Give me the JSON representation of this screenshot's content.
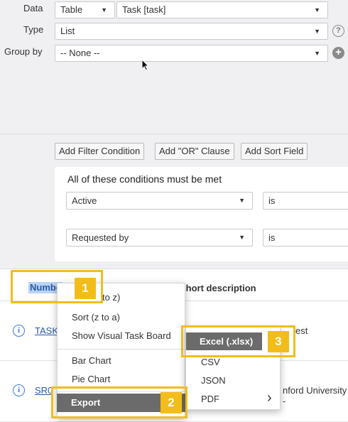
{
  "form": {
    "data_label": "Data",
    "data_source": "Table",
    "data_table": "Task [task]",
    "type_label": "Type",
    "type_value": "List",
    "groupby_label": "Group by",
    "groupby_value": "-- None --"
  },
  "filter_buttons": {
    "add_filter": "Add Filter Condition",
    "add_or": "Add \"OR\" Clause",
    "add_sort": "Add Sort Field"
  },
  "conditions": {
    "title": "All of these conditions must be met",
    "rows": [
      {
        "field": "Active",
        "operator": "is"
      },
      {
        "field": "Requested by",
        "operator": "is"
      }
    ]
  },
  "list": {
    "col_number_partial": "Numbe",
    "col_short_description": "Short description",
    "rows": [
      {
        "number_partial": "TASK",
        "desc_partial": "est"
      },
      {
        "number_partial": "SR0",
        "desc_partial": "nford University -"
      }
    ]
  },
  "context_menu": {
    "items": [
      "to z)",
      "Sort (z to a)",
      "Show Visual Task Board",
      "Bar Chart",
      "Pie Chart",
      "Export"
    ]
  },
  "export_submenu": {
    "items": [
      "Excel (.xlsx)",
      "CSV",
      "JSON",
      "PDF"
    ]
  },
  "callouts": [
    "1",
    "2",
    "3"
  ],
  "icons": {
    "help": "?",
    "plus": "+",
    "info": "i",
    "caret": "▼",
    "chevron_right": "›"
  },
  "colors": {
    "callout": "#f2bd1a",
    "highlight_item": "#6b6b6b",
    "link": "#2a5aa8",
    "info_icon": "#3b7bd6"
  }
}
